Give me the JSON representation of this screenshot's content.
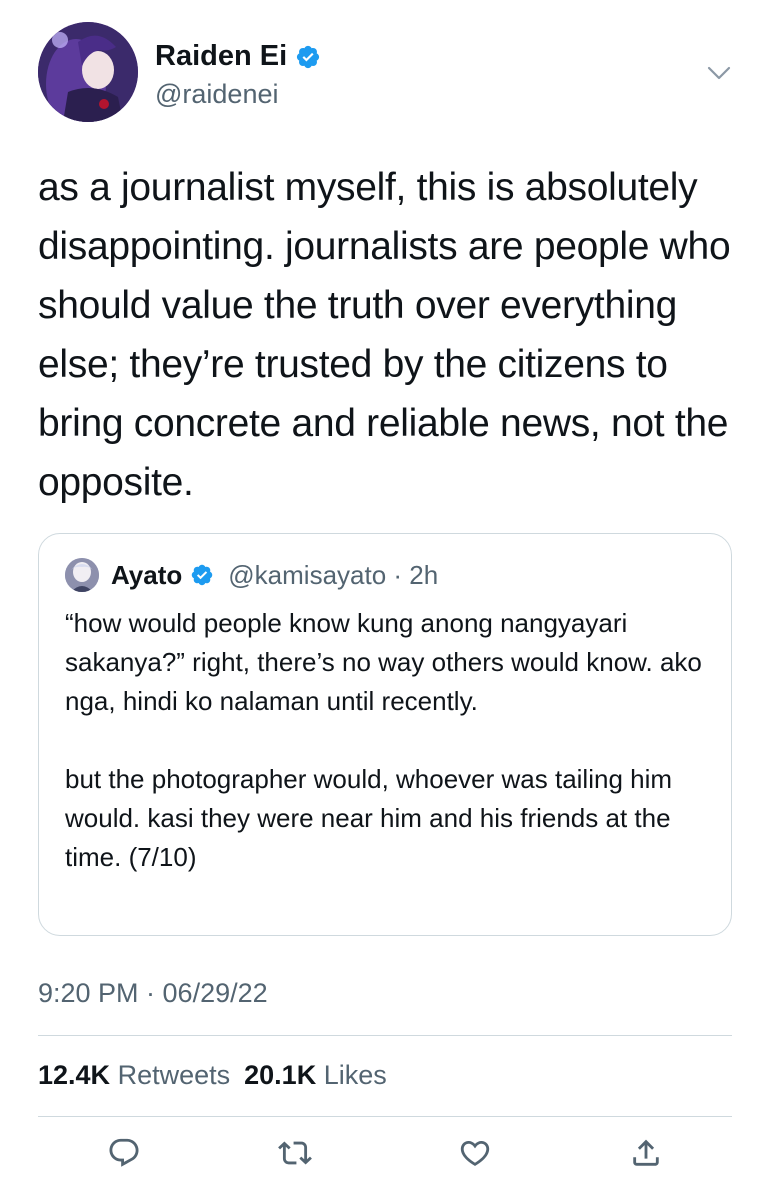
{
  "author": {
    "name": "Raiden Ei",
    "handle": "@raidenei",
    "verified": true
  },
  "tweet": {
    "text": "as a journalist myself, this is absolutely disappointing. journalists are people who should value the truth over everything else; they’re trusted by the citizens to bring concrete and reliable news, not the opposite.",
    "time": "9:20 PM · 06/29/22"
  },
  "quote": {
    "name": "Ayato",
    "handle": "@kamisayato · 2h",
    "verified": true,
    "text": "“how would people know kung anong nangyayari sakanya?” right, there’s no way others would know. ako nga, hindi ko nalaman until recently.\n\nbut the photographer would, whoever was tailing him would. kasi they were near him and his friends at the time. (7/10)"
  },
  "stats": {
    "retweets_count": "12.4K",
    "retweets_label": "Retweets",
    "likes_count": "20.1K",
    "likes_label": "Likes"
  },
  "icons": {
    "verified": "verified-badge-icon",
    "more": "chevron-down-icon",
    "reply": "reply-icon",
    "retweet": "retweet-icon",
    "like": "heart-icon",
    "share": "share-icon"
  },
  "colors": {
    "verified_blue": "#1d9bf0",
    "secondary_text": "#536471",
    "border": "#cfd9de"
  }
}
